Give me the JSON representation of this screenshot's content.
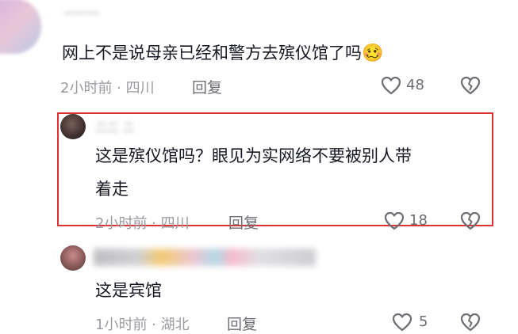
{
  "comments": [
    {
      "author": "一一一",
      "text": "网上不是说母亲已经和警方去殡仪馆了吗",
      "emoji": "🥴",
      "meta": "2小时前 · 四川",
      "reply_label": "回复",
      "likes": "48"
    },
    {
      "author": "二二 二",
      "text_line1": "这是殡仪馆吗？眼见为实网络不要被别人带",
      "text_line2": "着走",
      "meta": "2小时前 · 四川",
      "reply_label": "回复",
      "likes": "18"
    },
    {
      "author": "一一一一一一",
      "text": "这是宾馆",
      "meta": "1小时前 · 湖北",
      "reply_label": "回复",
      "likes": "5"
    }
  ],
  "colors": {
    "highlight": "#e03131",
    "muted": "#9a9aa0"
  }
}
